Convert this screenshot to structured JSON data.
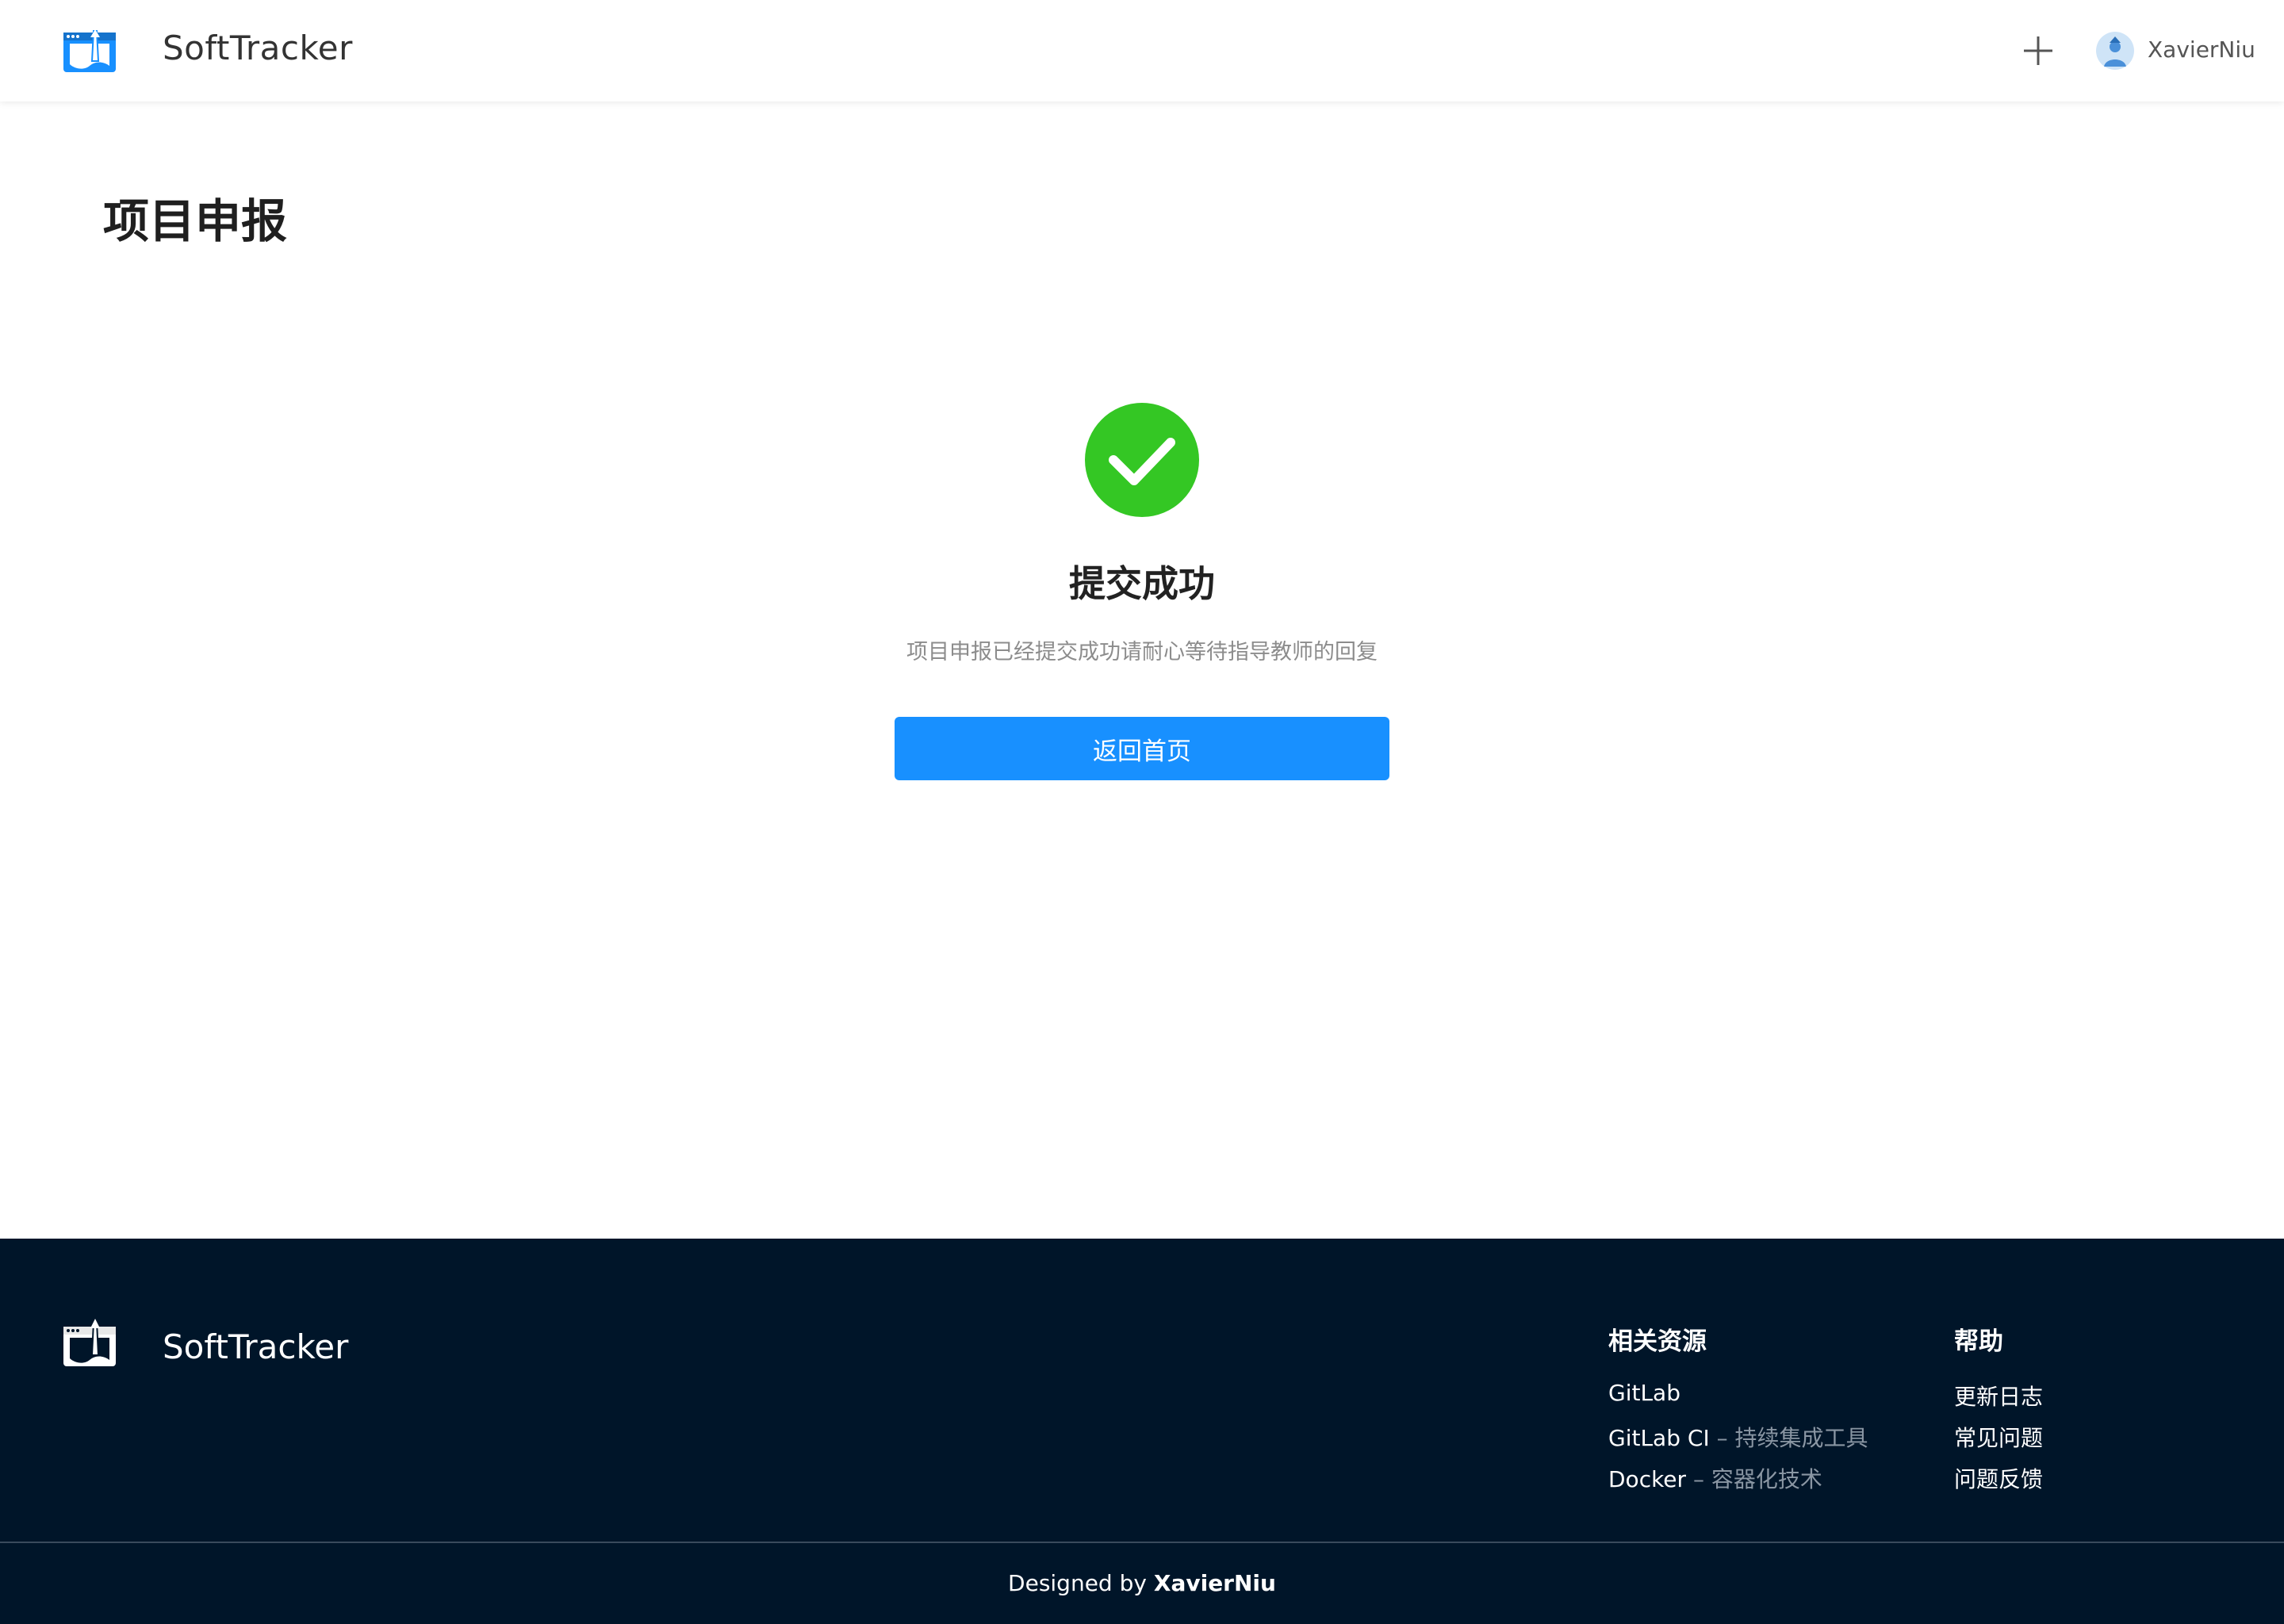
{
  "header": {
    "brand": "SoftTracker",
    "user": "XavierNiu",
    "icons": {
      "logo": "softtracker-logo-icon",
      "add": "plus-icon",
      "avatar": "user-avatar"
    }
  },
  "page": {
    "title": "项目申报"
  },
  "result": {
    "status_icon": "check-circle-icon",
    "status_color": "#34c724",
    "title": "提交成功",
    "subtitle": "项目申报已经提交成功请耐心等待指导教师的回复",
    "button_label": "返回首页",
    "button_color": "#1890ff"
  },
  "footer": {
    "brand": "SoftTracker",
    "background": "#001529",
    "resources": {
      "title": "相关资源",
      "links": [
        {
          "name": "GitLab",
          "desc": ""
        },
        {
          "name": "GitLab CI",
          "desc": " – 持续集成工具"
        },
        {
          "name": "Docker",
          "desc": " – 容器化技术"
        }
      ]
    },
    "help": {
      "title": "帮助",
      "links": [
        "更新日志",
        "常见问题",
        "问题反馈"
      ]
    },
    "credit_prefix": "Designed by ",
    "credit_name": "XavierNiu"
  }
}
